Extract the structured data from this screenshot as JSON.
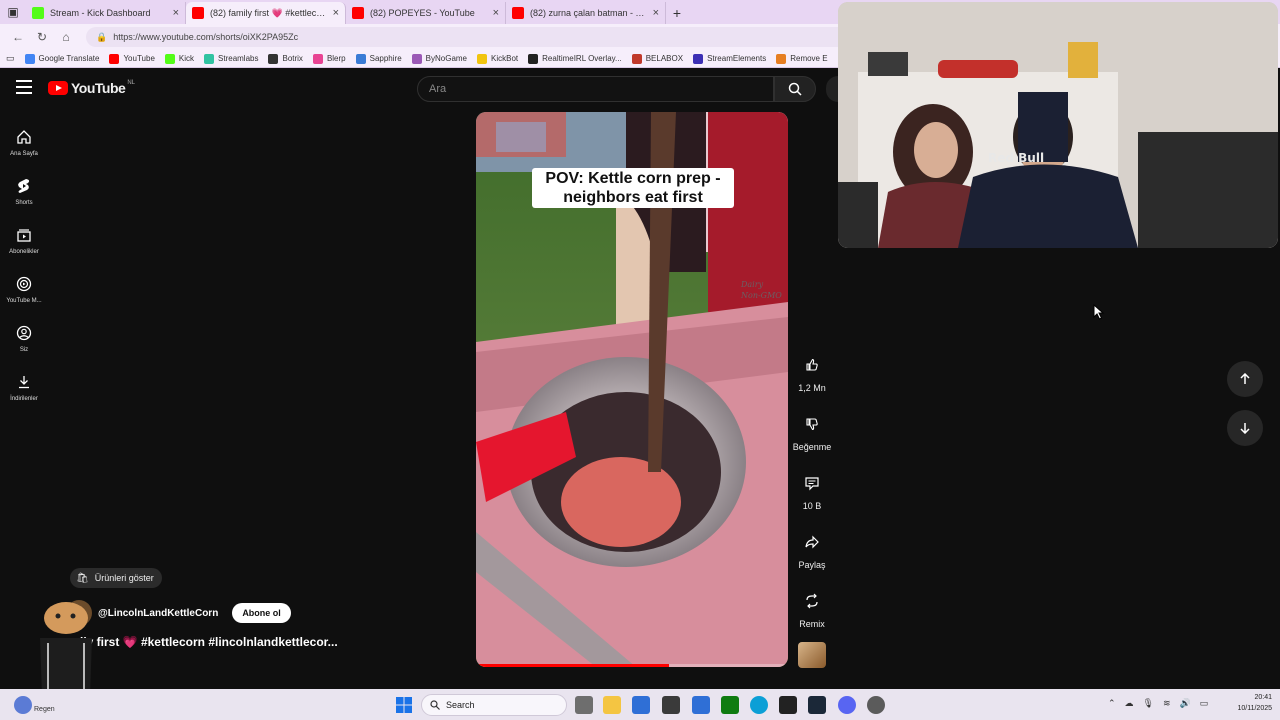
{
  "browser": {
    "tabs": [
      {
        "title": "Stream - Kick Dashboard",
        "favicon": "kick-icon",
        "color": "#53fc18",
        "active": false
      },
      {
        "title": "(82) family first 💗 #kettlecorn",
        "favicon": "youtube-icon",
        "color": "#ff0000",
        "active": true
      },
      {
        "title": "(82) POPEYES - YouTube",
        "favicon": "youtube-icon",
        "color": "#ff0000",
        "active": false
      },
      {
        "title": "(82) zurna çalan batman - YouTube",
        "favicon": "youtube-icon",
        "color": "#ff0000",
        "active": false
      }
    ],
    "url": "https://www.youtube.com/shorts/oiXK2PA95Zc",
    "bookmarks": [
      {
        "label": "Google Translate",
        "color": "#4285f4"
      },
      {
        "label": "YouTube",
        "color": "#ff0000"
      },
      {
        "label": "Kick",
        "color": "#53fc18"
      },
      {
        "label": "Streamlabs",
        "color": "#31c3a2"
      },
      {
        "label": "Botrix",
        "color": "#333333"
      },
      {
        "label": "Blerp",
        "color": "#e84393"
      },
      {
        "label": "Sapphire",
        "color": "#3a7bd5"
      },
      {
        "label": "ByNoGame",
        "color": "#9b59b6"
      },
      {
        "label": "KickBot",
        "color": "#f1c40f"
      },
      {
        "label": "RealtimeIRL Overlay...",
        "color": "#222222"
      },
      {
        "label": "BELABOX",
        "color": "#c0392b"
      },
      {
        "label": "StreamElements",
        "color": "#3c2fb4"
      },
      {
        "label": "Remove E",
        "color": "#e67e22"
      }
    ]
  },
  "youtube": {
    "logo_text": "YouTube",
    "country_code": "NL",
    "search_placeholder": "Ara",
    "nav": [
      {
        "label": "Ana Sayfa",
        "icon": "home-icon"
      },
      {
        "label": "Shorts",
        "icon": "shorts-icon"
      },
      {
        "label": "Abonelikler",
        "icon": "subscriptions-icon"
      },
      {
        "label": "YouTube M...",
        "icon": "youtube-music-icon"
      },
      {
        "label": "Siz",
        "icon": "you-icon"
      },
      {
        "label": "İndirilenler",
        "icon": "download-icon"
      }
    ],
    "short": {
      "caption": "POV: Kettle corn prep - neighbors eat first",
      "progress": 0.62,
      "channel": "@LincolnLandKettleCorn",
      "subscribe_label": "Abone ol",
      "title": "ily first 💗 #kettlecorn #lincolnlandkettlecor...",
      "products_label": "Ürünleri göster",
      "video_watermark_1": "Dairy",
      "video_watermark_2": "Non-GMO"
    },
    "actions": [
      {
        "label": "1,2 Mn",
        "icon": "like-icon"
      },
      {
        "label": "Beğenme",
        "icon": "dislike-icon"
      },
      {
        "label": "10 B",
        "icon": "comment-icon"
      },
      {
        "label": "Paylaş",
        "icon": "share-icon"
      },
      {
        "label": "Remix",
        "icon": "remix-icon"
      }
    ]
  },
  "webcam": {
    "shirt_text": "Red Bull"
  },
  "taskbar": {
    "search_label": "Search",
    "weather_label": "Regen",
    "time": "20:41",
    "date": "10/11/2025"
  }
}
